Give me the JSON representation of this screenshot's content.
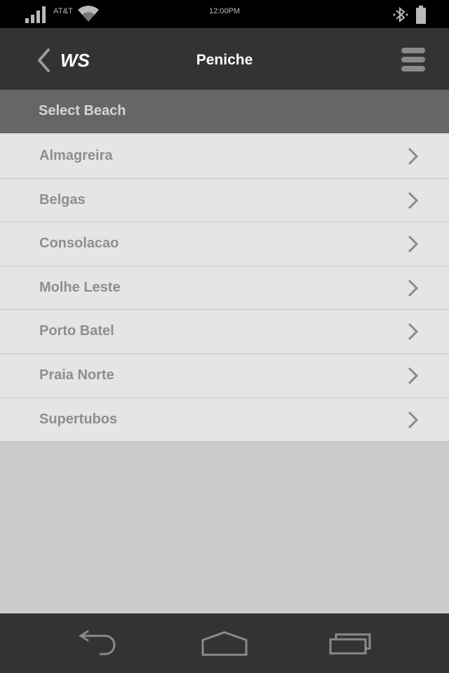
{
  "status_bar": {
    "carrier": "AT&T",
    "time": "12:00PM",
    "icons": [
      "signal-icon",
      "wifi-icon",
      "bluetooth-icon",
      "battery-icon"
    ]
  },
  "header": {
    "back_label": "WS",
    "title": "Peniche",
    "icons": [
      "chevron-left-icon",
      "menu-icon"
    ]
  },
  "section": {
    "title": "Select Beach"
  },
  "beaches": [
    {
      "name": "Almagreira"
    },
    {
      "name": "Belgas"
    },
    {
      "name": "Consolacao"
    },
    {
      "name": "Molhe Leste"
    },
    {
      "name": "Porto Batel"
    },
    {
      "name": "Praia Norte"
    },
    {
      "name": "Supertubos"
    }
  ],
  "nav_bar": {
    "icons": [
      "back-arrow-icon",
      "home-icon",
      "recent-apps-icon"
    ]
  },
  "colors": {
    "status_bar": "#000000",
    "header": "#333333",
    "section_header": "#666666",
    "list_item": "#e5e5e5",
    "list_text": "#8e8e8e",
    "empty_area": "#cccccc",
    "nav_bar": "#333333"
  }
}
